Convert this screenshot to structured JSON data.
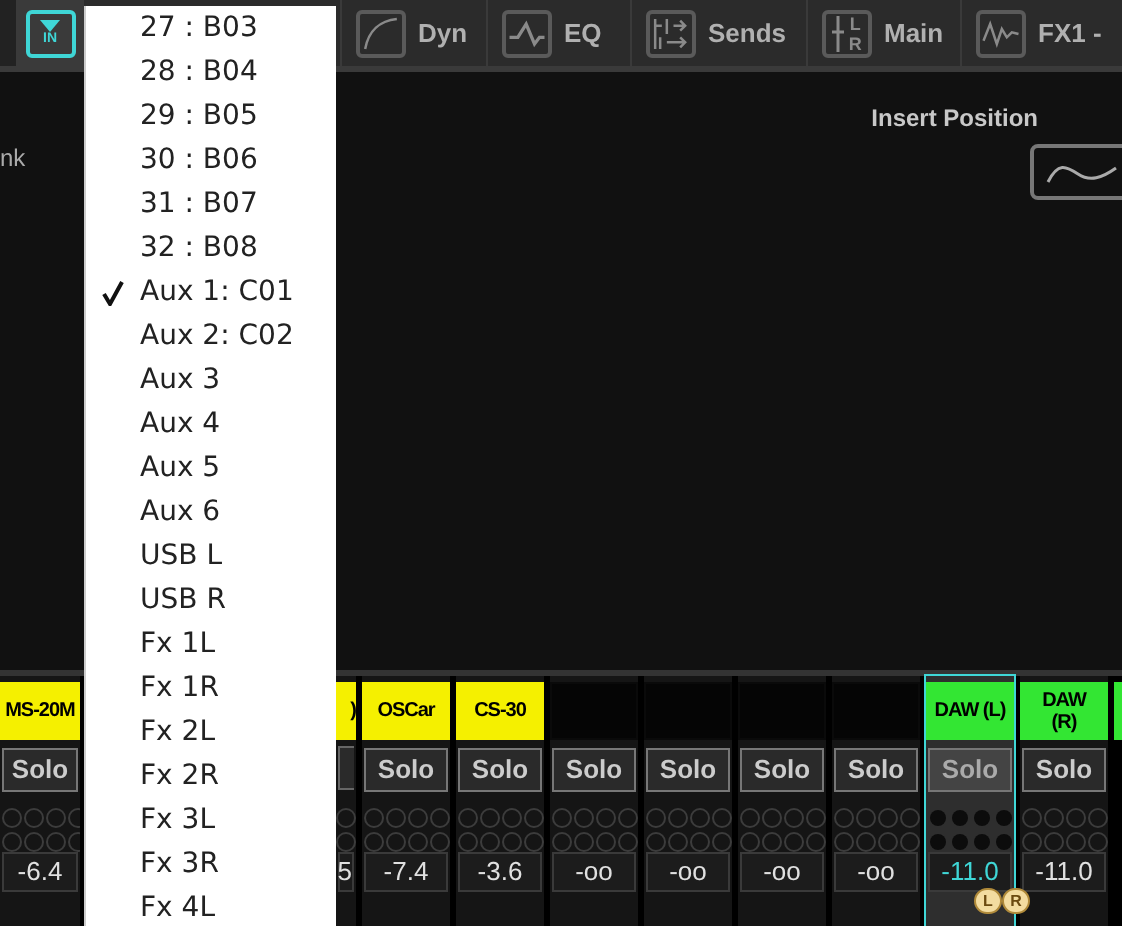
{
  "tabs": [
    {
      "kind": "input",
      "icon_text": "IN",
      "selected": true
    },
    {
      "kind": "dyn",
      "label": "Dyn",
      "selected": false
    },
    {
      "kind": "eq",
      "label": "EQ",
      "selected": false
    },
    {
      "kind": "sends",
      "label": "Sends",
      "selected": false
    },
    {
      "kind": "main",
      "label": "Main",
      "icon_letters": [
        "L",
        "R"
      ],
      "selected": false
    },
    {
      "kind": "fx",
      "label": "FX1 -",
      "selected": false
    }
  ],
  "panel": {
    "cut_label": "nk",
    "insert_position_label": "Insert Position"
  },
  "channels": [
    {
      "kind": "full",
      "label": "MS-20M",
      "color": "#f5f000",
      "value": "-6.4",
      "solo": "Solo",
      "selected": false
    },
    {
      "kind": "covered"
    },
    {
      "kind": "partial",
      "label": ")",
      "color": "#f5f000",
      "value": "5",
      "selected": false
    },
    {
      "kind": "full",
      "label": "OSCar",
      "color": "#f5f000",
      "value": "-7.4",
      "solo": "Solo",
      "selected": false
    },
    {
      "kind": "full",
      "label": "CS-30",
      "color": "#f5f000",
      "value": "-3.6",
      "solo": "Solo",
      "selected": false
    },
    {
      "kind": "full",
      "value": "-oo",
      "solo": "Solo",
      "selected": false
    },
    {
      "kind": "full",
      "value": "-oo",
      "solo": "Solo",
      "selected": false
    },
    {
      "kind": "full",
      "value": "-oo",
      "solo": "Solo",
      "selected": false
    },
    {
      "kind": "full",
      "value": "-oo",
      "solo": "Solo",
      "selected": false
    },
    {
      "kind": "full",
      "label": "DAW (L)",
      "color": "#33e633",
      "value": "-11.0",
      "solo": "Solo",
      "selected": true
    },
    {
      "kind": "full",
      "label": "DAW\n(R)",
      "color": "#33e633",
      "value": "-11.0",
      "solo": "Solo",
      "selected": false
    },
    {
      "kind": "edge",
      "color": "#33e633"
    }
  ],
  "stereo_link": [
    "L",
    "R"
  ],
  "dropdown": {
    "items": [
      {
        "label": "27 : B03",
        "selected": false
      },
      {
        "label": "28 : B04",
        "selected": false
      },
      {
        "label": "29 : B05",
        "selected": false
      },
      {
        "label": "30 : B06",
        "selected": false
      },
      {
        "label": "31 : B07",
        "selected": false
      },
      {
        "label": "32 : B08",
        "selected": false
      },
      {
        "label": "Aux 1: C01",
        "selected": true
      },
      {
        "label": "Aux 2: C02",
        "selected": false
      },
      {
        "label": "Aux 3",
        "selected": false
      },
      {
        "label": "Aux 4",
        "selected": false
      },
      {
        "label": "Aux 5",
        "selected": false
      },
      {
        "label": "Aux 6",
        "selected": false
      },
      {
        "label": "USB L",
        "selected": false
      },
      {
        "label": "USB R",
        "selected": false
      },
      {
        "label": "Fx 1L",
        "selected": false
      },
      {
        "label": "Fx 1R",
        "selected": false
      },
      {
        "label": "Fx 2L",
        "selected": false
      },
      {
        "label": "Fx 2R",
        "selected": false
      },
      {
        "label": "Fx 3L",
        "selected": false
      },
      {
        "label": "Fx 3R",
        "selected": false
      },
      {
        "label": "Fx 4L",
        "selected": false
      }
    ]
  }
}
